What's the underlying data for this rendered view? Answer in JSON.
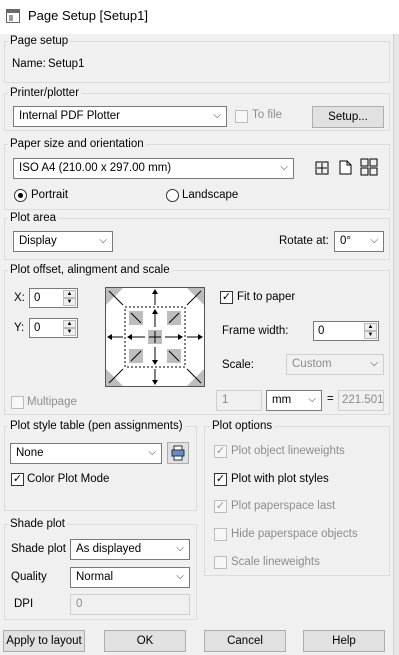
{
  "window": {
    "title": "Page Setup [Setup1]"
  },
  "page_setup": {
    "group_label": "Page setup",
    "name_label": "Name:",
    "name_value": "Setup1"
  },
  "printer": {
    "group_label": "Printer/plotter",
    "selected": "Internal PDF Plotter",
    "to_file_label": "To file",
    "setup_button": "Setup..."
  },
  "paper": {
    "group_label": "Paper size and orientation",
    "size": "ISO A4 (210.00 x 297.00 mm)",
    "portrait_label": "Portrait",
    "landscape_label": "Landscape",
    "orientation": "Portrait"
  },
  "plot_area": {
    "group_label": "Plot area",
    "selected": "Display",
    "rotate_label": "Rotate at:",
    "rotate_value": "0°"
  },
  "offset": {
    "group_label": "Plot offset, alingment and scale",
    "x_label": "X:",
    "x_value": "0",
    "y_label": "Y:",
    "y_value": "0",
    "fit_to_paper_label": "Fit to paper",
    "frame_width_label": "Frame width:",
    "frame_width_value": "0",
    "scale_label": "Scale:",
    "scale_value": "Custom",
    "multipage_label": "Multipage",
    "scale_num": "1",
    "unit": "mm",
    "equals": "=",
    "scale_den": "221.501"
  },
  "plot_style": {
    "group_label": "Plot style table (pen assignments)",
    "selected": "None",
    "color_plot_mode_label": "Color Plot Mode"
  },
  "plot_options": {
    "group_label": "Plot options",
    "items": [
      {
        "label": "Plot object lineweights",
        "checked": true,
        "enabled": false
      },
      {
        "label": "Plot with plot styles",
        "checked": true,
        "enabled": true
      },
      {
        "label": "Plot paperspace last",
        "checked": true,
        "enabled": false
      },
      {
        "label": "Hide paperspace objects",
        "checked": false,
        "enabled": false
      },
      {
        "label": "Scale lineweights",
        "checked": false,
        "enabled": false
      }
    ]
  },
  "shade": {
    "group_label": "Shade plot",
    "shade_plot_label": "Shade plot",
    "shade_plot_value": "As displayed",
    "quality_label": "Quality",
    "quality_value": "Normal",
    "dpi_label": "DPI",
    "dpi_value": "0"
  },
  "buttons": {
    "apply": "Apply to layout",
    "ok": "OK",
    "cancel": "Cancel",
    "help": "Help"
  }
}
